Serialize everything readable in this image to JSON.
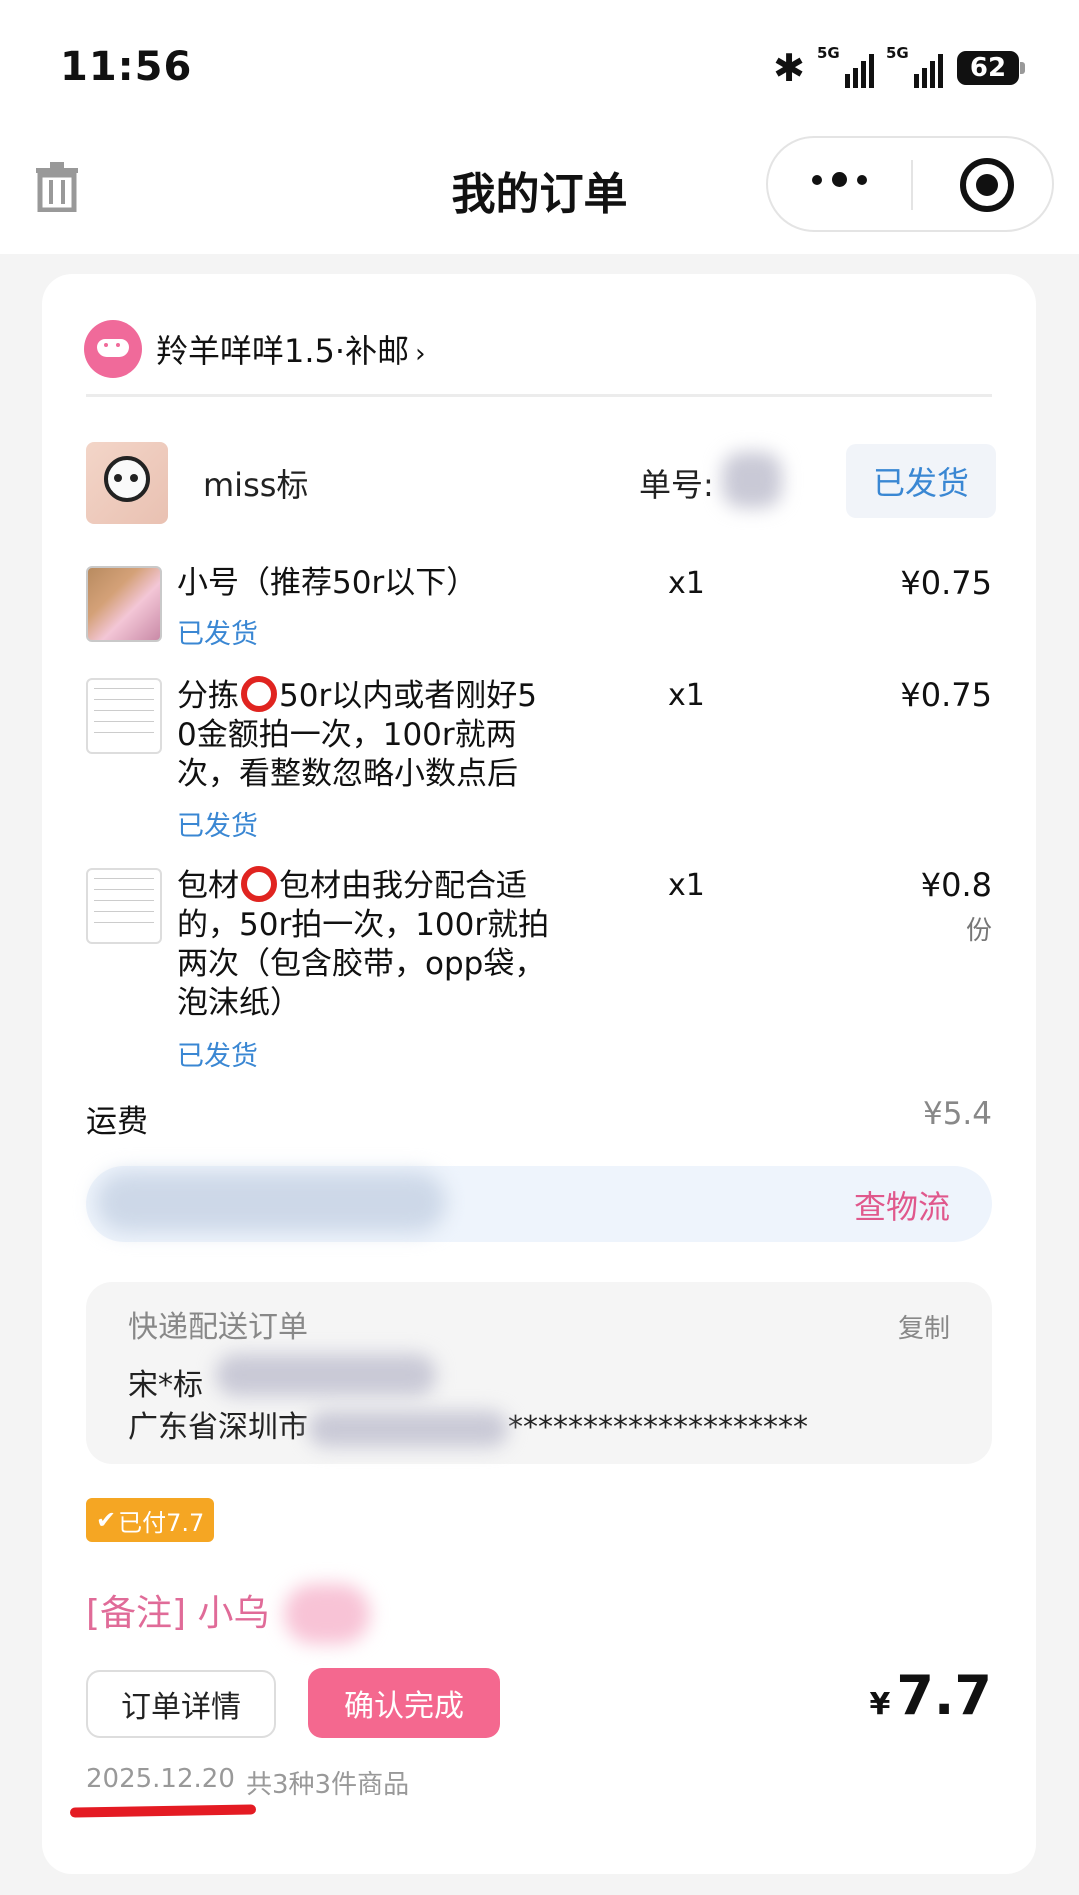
{
  "status_bar": {
    "time": "11:56",
    "network_1": "5G",
    "network_2": "5G",
    "battery": "62"
  },
  "nav": {
    "title": "我的订单"
  },
  "shop": {
    "name": "羚羊咩咩1.5·补邮",
    "chevron": "›"
  },
  "order": {
    "buyer": "miss标",
    "order_no_label": "单号:",
    "status": "已发货",
    "items": [
      {
        "name": "小号（推荐50r以下）",
        "status": "已发货",
        "qty": "x1",
        "price": "¥0.75"
      },
      {
        "name_part1": "分拣",
        "name_part2": "50r以内或者刚好5",
        "name_line2": "0金额拍一次，100r就两",
        "name_line3": "次，看整数忽略小数点后",
        "status": "已发货",
        "qty": "x1",
        "price": "¥0.75"
      },
      {
        "name_part1": "包材",
        "name_part2": "包材由我分配合适",
        "name_line2": "的，50r拍一次，100r就拍",
        "name_line3": "两次（包含胶带，opp袋，",
        "name_line4": "泡沫纸）",
        "status": "已发货",
        "qty": "x1",
        "price": "¥0.8",
        "unit": "份"
      }
    ],
    "shipping_label": "运费",
    "shipping_fee": "¥5.4",
    "logistics_link": "查物流",
    "address": {
      "title": "快递配送订单",
      "copy": "复制",
      "name": "宋*标",
      "addr_prefix": "广东省深圳市",
      "addr_mask": "********************"
    },
    "paid_badge": "已付7.7",
    "remark": "[备注] 小乌",
    "detail_button": "订单详情",
    "confirm_button": "确认完成",
    "total_symbol": "¥",
    "total": "7.7",
    "date": "2025.12.20",
    "count_text": "共3种3件商品"
  },
  "colors": {
    "accent_pink": "#f4688f",
    "link_blue": "#3a87d3",
    "badge_orange": "#f5a623",
    "underline_red": "#e41b23"
  }
}
